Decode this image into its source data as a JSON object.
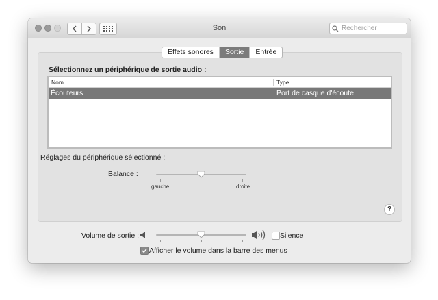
{
  "window": {
    "title": "Son",
    "search_placeholder": "Rechercher",
    "traffic_lights": [
      "close",
      "minimize",
      "zoom"
    ],
    "nav_back_icon": "chevron-left-icon",
    "nav_forward_icon": "chevron-right-icon",
    "show_all_icon": "grid-icon"
  },
  "tabs": [
    {
      "label": "Effets sonores",
      "active": false
    },
    {
      "label": "Sortie",
      "active": true
    },
    {
      "label": "Entrée",
      "active": false
    }
  ],
  "output": {
    "section_title": "Sélectionnez un périphérique de sortie audio :",
    "columns": [
      "Nom",
      "Type"
    ],
    "rows": [
      {
        "name": "Écouteurs",
        "type": "Port de casque d'écoute",
        "selected": true
      }
    ]
  },
  "device_settings": {
    "title": "Réglages du périphérique sélectionné :",
    "balance_label": "Balance :",
    "balance_left": "gauche",
    "balance_right": "droite",
    "balance_value": 0.5
  },
  "help_label": "?",
  "volume": {
    "label": "Volume de sortie :",
    "value": 0.5,
    "mute_label": "Silence",
    "mute_checked": false,
    "menu_bar_label": "Afficher le volume dans la barre des menus",
    "menu_bar_checked": true
  },
  "colors": {
    "selection": "#787878",
    "active_tab": "#7b7b7b",
    "window_bg": "#ececec"
  }
}
